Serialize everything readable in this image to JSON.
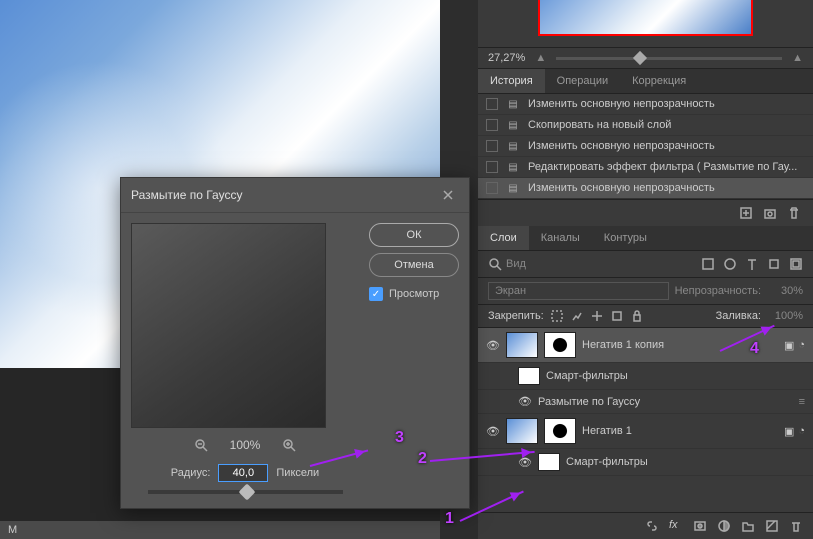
{
  "dialog": {
    "title": "Размытие по Гауссу",
    "ok": "ОК",
    "cancel": "Отмена",
    "preview": "Просмотр",
    "zoom": "100%",
    "radius_label": "Радиус:",
    "radius_value": "40,0",
    "radius_unit": "Пиксели"
  },
  "navigator": {
    "zoom": "27,27%"
  },
  "tabs_history": {
    "history": "История",
    "actions": "Операции",
    "correction": "Коррекция"
  },
  "history": {
    "items": [
      "Изменить основную непрозрачность",
      "Скопировать на новый слой",
      "Изменить основную непрозрачность",
      "Редактировать эффект фильтра ( Размытие по Гау...",
      "Изменить основную непрозрачность"
    ]
  },
  "tabs_layers": {
    "layers": "Слои",
    "channels": "Каналы",
    "paths": "Контуры"
  },
  "layers_toolbar": {
    "search_placeholder": "Вид",
    "blend_mode": "Экран",
    "opacity_label": "Непрозрачность:",
    "opacity_value": "30%",
    "lock_label": "Закрепить:",
    "fill_label": "Заливка:",
    "fill_value": "100%"
  },
  "layers": {
    "l1": "Негатив 1 копия",
    "l1_sf": "Смарт-фильтры",
    "l1_gb": "Размытие по Гауссу",
    "l2": "Негатив 1",
    "l2_sf": "Смарт-фильтры"
  },
  "annotations": {
    "n1": "1",
    "n2": "2",
    "n3": "3",
    "n4": "4"
  },
  "statusbar": {
    "m": "М"
  }
}
